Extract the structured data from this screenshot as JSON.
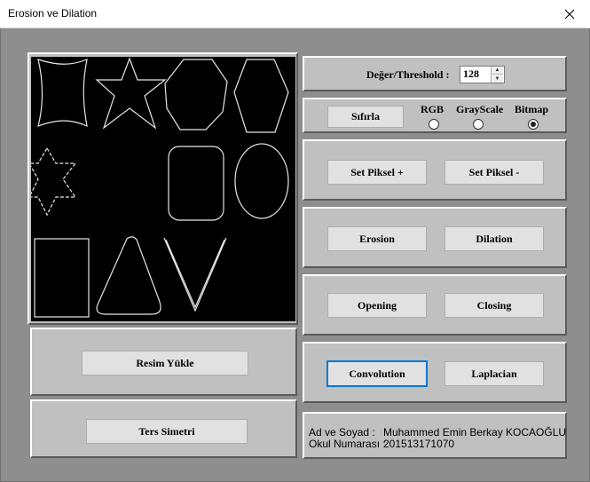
{
  "window": {
    "title": "Erosion ve Dilation",
    "close_icon": "close-icon"
  },
  "threshold": {
    "label": "Değer/Threshold :",
    "value": "128"
  },
  "mode": {
    "reset_label": "Sıfırla",
    "options": [
      {
        "label": "RGB",
        "checked": false
      },
      {
        "label": "GrayScale",
        "checked": false
      },
      {
        "label": "Bitmap",
        "checked": true
      }
    ]
  },
  "pixel": {
    "plus_label": "Set Piksel +",
    "minus_label": "Set Piksel -"
  },
  "morph": {
    "erosion_label": "Erosion",
    "dilation_label": "Dilation"
  },
  "morph2": {
    "opening_label": "Opening",
    "closing_label": "Closing"
  },
  "filters": {
    "convolution_label": "Convolution",
    "laplacian_label": "Laplacian"
  },
  "load": {
    "label": "Resim Yükle"
  },
  "mirror": {
    "label": "Ters Simetri"
  },
  "info": {
    "name_key": "Ad ve Soyad :",
    "name_value": "Muhammed Emin Berkay KOCAOĞLU",
    "number_key": "Okul Numarası :",
    "number_value": "201513171070"
  }
}
